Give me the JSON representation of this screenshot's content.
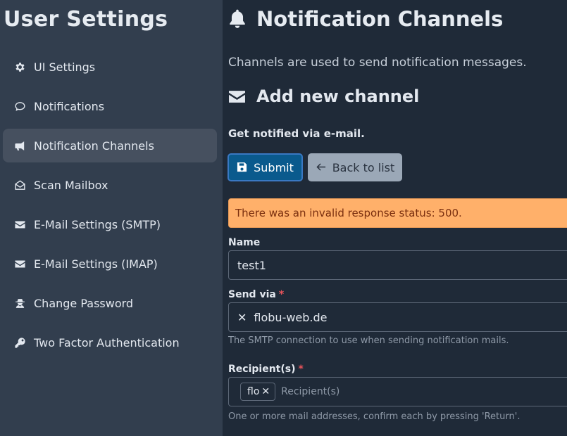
{
  "sidebar": {
    "title": "User Settings",
    "items": [
      {
        "label": "UI Settings",
        "icon": "gear-icon"
      },
      {
        "label": "Notifications",
        "icon": "speech-bubble-icon"
      },
      {
        "label": "Notification Channels",
        "icon": "megaphone-icon",
        "active": true
      },
      {
        "label": "Scan Mailbox",
        "icon": "envelope-open-icon"
      },
      {
        "label": "E-Mail Settings (SMTP)",
        "icon": "envelope-icon"
      },
      {
        "label": "E-Mail Settings (IMAP)",
        "icon": "envelope-icon"
      },
      {
        "label": "Change Password",
        "icon": "user-secret-icon"
      },
      {
        "label": "Two Factor Authentication",
        "icon": "key-icon"
      }
    ]
  },
  "main": {
    "title": "Notification Channels",
    "title_icon": "bell-icon",
    "lead": "Channels are used to send notification messages.",
    "section_title": "Add new channel",
    "section_icon": "envelope-icon",
    "subtitle": "Get notified via e-mail.",
    "buttons": {
      "submit": "Submit",
      "back": "Back to list"
    },
    "alert": "There was an invalid response status: 500.",
    "form": {
      "name": {
        "label": "Name",
        "value": "test1"
      },
      "send_via": {
        "label": "Send via",
        "required_mark": "*",
        "value": "flobu-web.de",
        "clear": "✕",
        "hint": "The SMTP connection to use when sending notification mails."
      },
      "recipients": {
        "label": "Recipient(s)",
        "required_mark": "*",
        "tags": [
          "flo"
        ],
        "tag_remove": "✕",
        "placeholder": "Recipient(s)",
        "hint": "One or more mail addresses, confirm each by pressing 'Return'."
      }
    }
  },
  "colors": {
    "background": "#1f2a38",
    "sidebar": "#323e4e",
    "active_item": "#46505f",
    "primary": "#0a5a8d",
    "secondary": "#9ba8b7",
    "warning": "#ffb06a",
    "required": "#e8545b"
  }
}
